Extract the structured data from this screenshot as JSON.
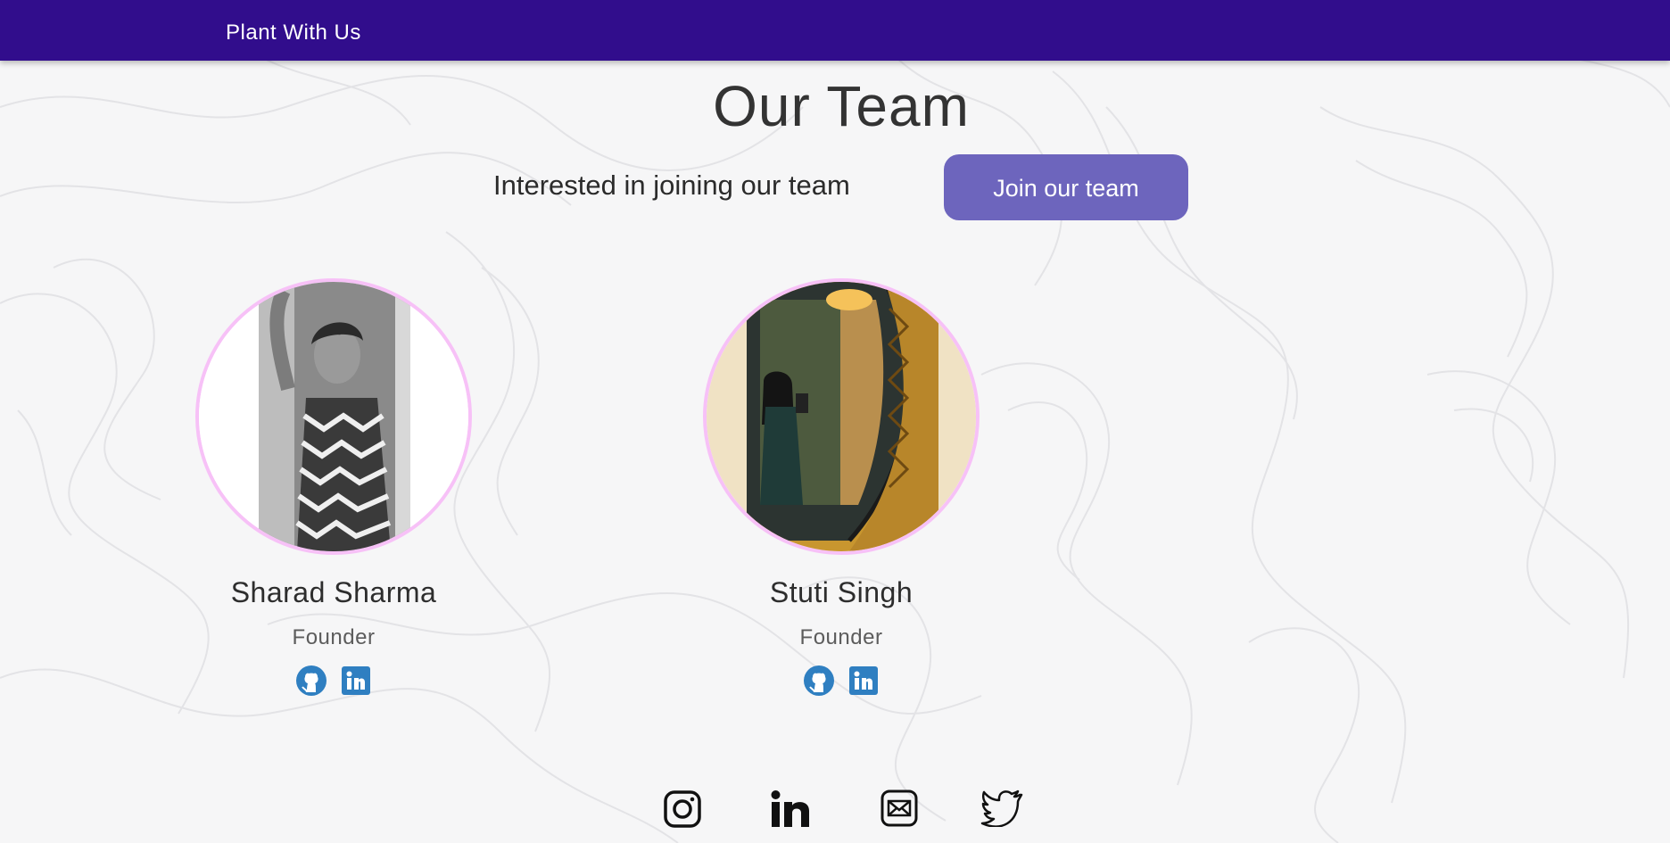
{
  "nav": {
    "brand": "Plant With Us"
  },
  "page": {
    "title": "Our Team",
    "join_prompt": "Interested in joining our team",
    "join_button": "Join our team"
  },
  "team": [
    {
      "name": "Sharad Sharma",
      "role": "Founder",
      "links": [
        "github-icon",
        "linkedin-icon"
      ]
    },
    {
      "name": "Stuti Singh",
      "role": "Founder",
      "links": [
        "github-icon",
        "linkedin-icon"
      ]
    }
  ],
  "footer": {
    "icons": [
      "instagram-icon",
      "linkedin-icon",
      "mail-icon",
      "twitter-icon"
    ]
  },
  "colors": {
    "navbar": "#310d8c",
    "button": "#6d65bd",
    "avatar_border": "#f7c1f7",
    "member_icon": "#2f7fc1"
  }
}
